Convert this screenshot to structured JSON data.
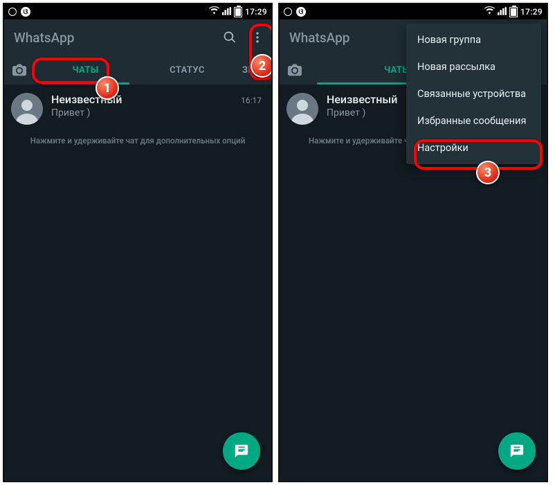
{
  "statusbar": {
    "time": "17:29"
  },
  "appbar": {
    "title": "WhatsApp"
  },
  "tabs": {
    "chats": "ЧАТЫ",
    "status": "СТАТУС",
    "calls_full": "ЗВОНКИ",
    "calls_cut1": "ЗВО",
    "calls_cut2": "С"
  },
  "chat": {
    "name": "Неизвестный",
    "message": "Привет )",
    "time": "16:17"
  },
  "hint": {
    "full": "Нажмите и удерживайте чат для дополнительных опций",
    "cut": "Нажмите и удерживайте чат д"
  },
  "menu": {
    "items": [
      "Новая группа",
      "Новая рассылка",
      "Связанные устройства",
      "Избранные сообщения",
      "Настройки"
    ]
  },
  "badges": {
    "n1": "1",
    "n2": "2",
    "n3": "3"
  }
}
